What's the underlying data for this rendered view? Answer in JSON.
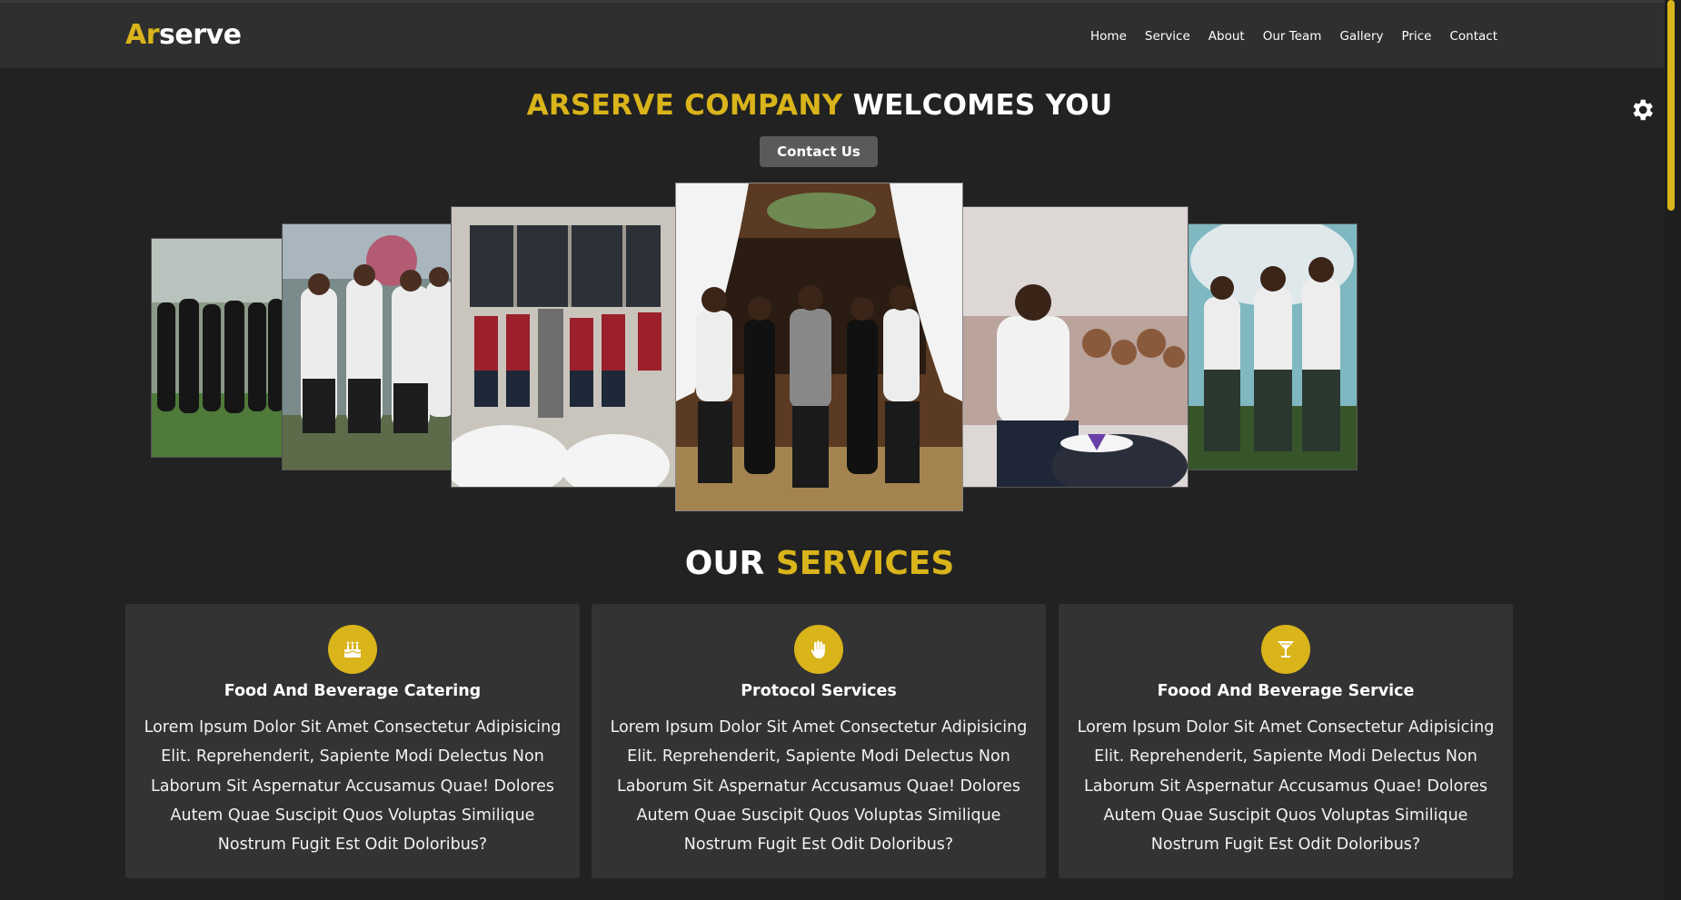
{
  "header": {
    "logo_part1": "Ar",
    "logo_part2": "serve",
    "nav": [
      "Home",
      "Service",
      "About",
      "Our Team",
      "Gallery",
      "Price",
      "Contact"
    ]
  },
  "hero": {
    "title_highlight": "ARSERVE COMPANY",
    "title_rest": "WELCOMES YOU",
    "button": "Contact Us"
  },
  "gallery": {
    "photos": [
      "team-in-black-garden",
      "waitresses-white-shirts",
      "staff-red-vests",
      "couples-at-entrance",
      "waitress-serving-table",
      "waiters-floral-stage"
    ]
  },
  "services": {
    "title_white": "OUR",
    "title_yellow": "SERVICES",
    "cards": [
      {
        "icon": "cake-icon",
        "title": "Food And Beverage Catering",
        "text": "Lorem Ipsum Dolor Sit Amet Consectetur Adipisicing Elit. Reprehenderit, Sapiente Modi Delectus Non Laborum Sit Aspernatur Accusamus Quae! Dolores Autem Quae Suscipit Quos Voluptas Similique Nostrum Fugit Est Odit Doloribus?"
      },
      {
        "icon": "hand-icon",
        "title": "Protocol Services",
        "text": "Lorem Ipsum Dolor Sit Amet Consectetur Adipisicing Elit. Reprehenderit, Sapiente Modi Delectus Non Laborum Sit Aspernatur Accusamus Quae! Dolores Autem Quae Suscipit Quos Voluptas Similique Nostrum Fugit Est Odit Doloribus?"
      },
      {
        "icon": "cocktail-icon",
        "title": "Foood And Beverage Service",
        "text": "Lorem Ipsum Dolor Sit Amet Consectetur Adipisicing Elit. Reprehenderit, Sapiente Modi Delectus Non Laborum Sit Aspernatur Accusamus Quae! Dolores Autem Quae Suscipit Quos Voluptas Similique Nostrum Fugit Est Odit Doloribus?"
      }
    ]
  },
  "colors": {
    "accent": "#d9b41a",
    "background": "#222222",
    "header": "#2f2f2f",
    "card": "#333333"
  }
}
